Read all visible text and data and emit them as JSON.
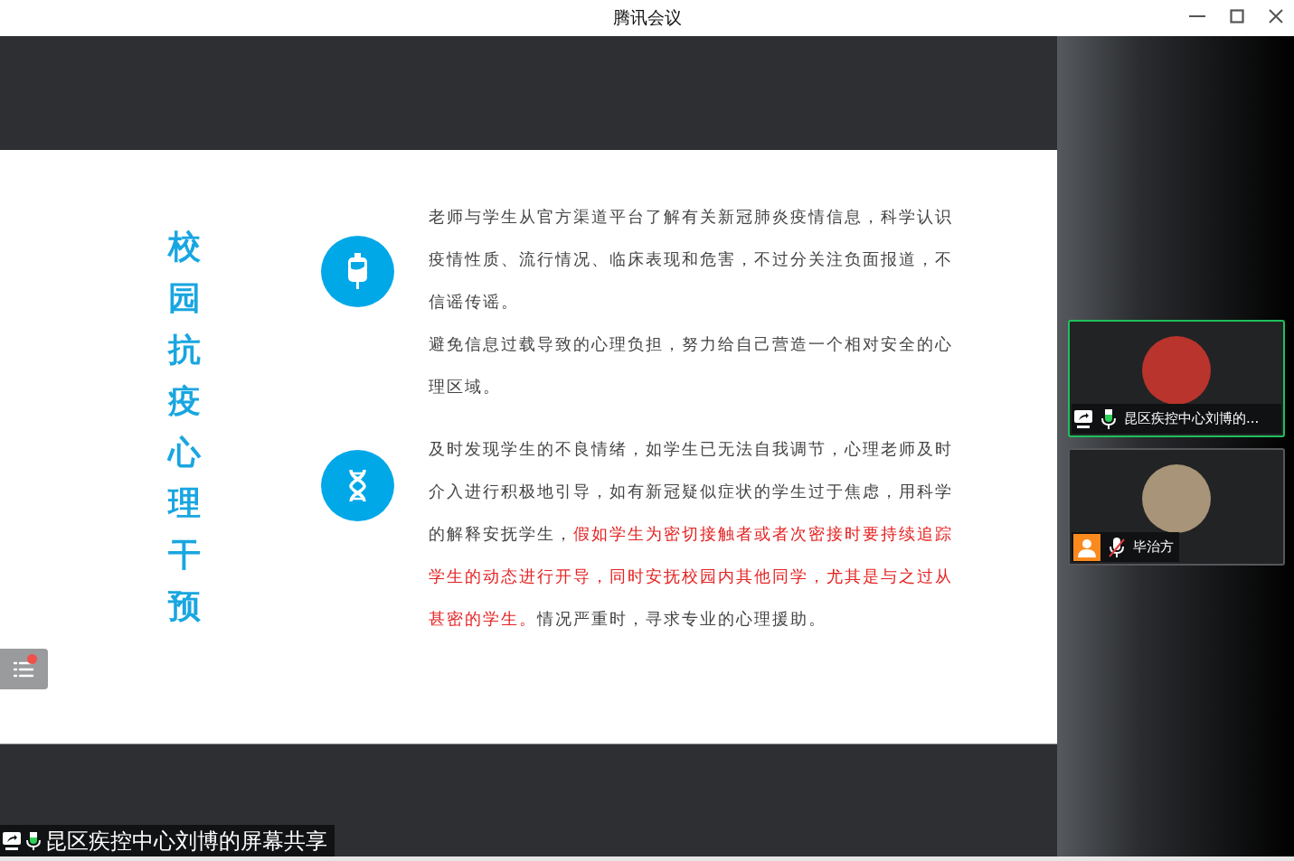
{
  "window": {
    "title": "腾讯会议"
  },
  "slide": {
    "title": "校园抗疫心理干预",
    "sections": [
      {
        "paragraphs": [
          [
            {
              "text": "老师与学生从官方渠道平台了解有关新冠肺炎疫情信息，科学认识疫情性质、流行情况、临床表现和危害，不过分关注负面报道，不信谣传谣。",
              "highlighted": false
            }
          ],
          [
            {
              "text": "避免信息过载导致的心理负担，努力给自己营造一个相对安全的心理区域。",
              "highlighted": false
            }
          ]
        ]
      },
      {
        "paragraphs": [
          [
            {
              "text": "及时发现学生的不良情绪，如学生已无法自我调节，心理老师及时介入进行积极地引导，如有新冠疑似症状的学生过于焦虑，用科学的解释安抚学生，",
              "highlighted": false
            },
            {
              "text": "假如学生为密切接触者或者次密接时要持续追踪学生的动态进行开导，同时安抚校园内其他同学，尤其是与之过从甚密的学生。",
              "highlighted": true
            },
            {
              "text": "情况严重时，寻求专业的心理援助。",
              "highlighted": false
            }
          ]
        ]
      }
    ]
  },
  "toc_button": {
    "notification": true
  },
  "share_label": {
    "text": "昆区疾控中心刘博的屏幕共享",
    "muted": false
  },
  "participants": [
    {
      "name": "昆区疾控中心刘博的...",
      "sharing": true,
      "muted": false,
      "active_speaker": true
    },
    {
      "name": "毕治方",
      "sharing": false,
      "muted": true,
      "active_speaker": false
    }
  ]
}
